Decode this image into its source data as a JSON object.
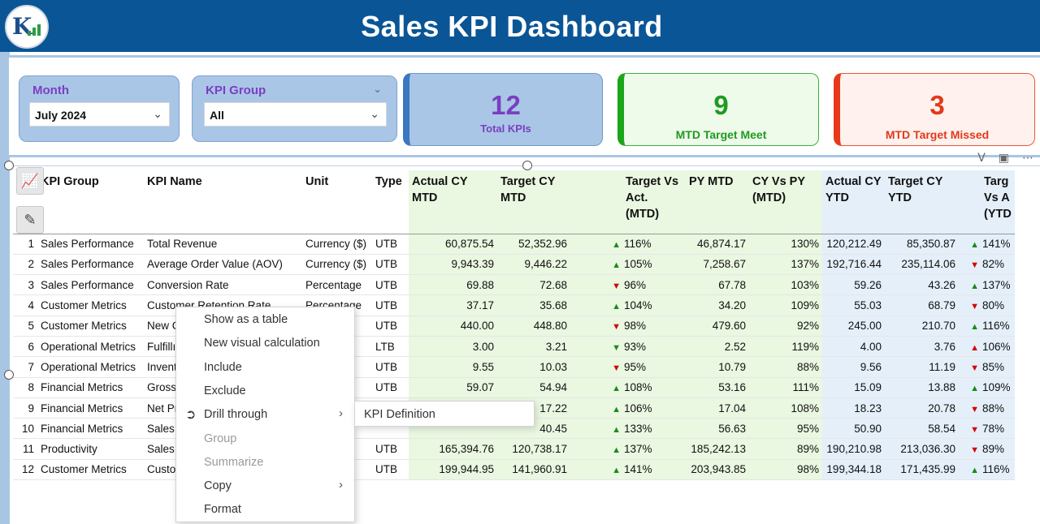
{
  "header": {
    "title": "Sales KPI Dashboard"
  },
  "slicers": {
    "month": {
      "label": "Month",
      "value": "July 2024"
    },
    "kpi_group": {
      "label": "KPI Group",
      "value": "All"
    }
  },
  "cards": {
    "total": {
      "value": "12",
      "caption": "Total KPIs"
    },
    "meet": {
      "value": "9",
      "caption": "MTD Target Meet"
    },
    "missed": {
      "value": "3",
      "caption": "MTD Target Missed"
    }
  },
  "colors": {
    "header_bg": "#0a5596",
    "meet_green": "#1f9a1f",
    "missed_red": "#e03a1a",
    "purple": "#7a3fbf",
    "mtd_bg": "#eaf7e1",
    "ytd_bg": "#e4effa"
  },
  "table": {
    "columns": [
      "KPI Group",
      "KPI Name",
      "Unit",
      "Type",
      "Actual CY MTD",
      "Target CY MTD",
      "Target Vs Act. (MTD)",
      "PY MTD",
      "CY Vs PY (MTD)",
      "Actual CY YTD",
      "Target CY YTD",
      "Targ Vs A (YTD"
    ],
    "rows": [
      {
        "no": "1",
        "group": "Sales Performance",
        "name": "Total Revenue",
        "unit": "Currency ($)",
        "type": "UTB",
        "act_mtd": "60,875.54",
        "tgt_mtd": "52,352.96",
        "mtd_dir": "up",
        "mtd_pct": "116%",
        "py_mtd": "46,874.17",
        "cy_py": "130%",
        "act_ytd": "120,212.49",
        "tgt_ytd": "85,350.87",
        "ytd_dir": "up",
        "ytd_pct": "141%"
      },
      {
        "no": "2",
        "group": "Sales Performance",
        "name": "Average Order Value (AOV)",
        "unit": "Currency ($)",
        "type": "UTB",
        "act_mtd": "9,943.39",
        "tgt_mtd": "9,446.22",
        "mtd_dir": "up",
        "mtd_pct": "105%",
        "py_mtd": "7,258.67",
        "cy_py": "137%",
        "act_ytd": "192,716.44",
        "tgt_ytd": "235,114.06",
        "ytd_dir": "down",
        "ytd_pct": "82%"
      },
      {
        "no": "3",
        "group": "Sales Performance",
        "name": "Conversion Rate",
        "unit": "Percentage",
        "type": "UTB",
        "act_mtd": "69.88",
        "tgt_mtd": "72.68",
        "mtd_dir": "down",
        "mtd_pct": "96%",
        "py_mtd": "67.78",
        "cy_py": "103%",
        "act_ytd": "59.26",
        "tgt_ytd": "43.26",
        "ytd_dir": "up",
        "ytd_pct": "137%"
      },
      {
        "no": "4",
        "group": "Customer Metrics",
        "name": "Customer Retention Rate",
        "unit": "Percentage",
        "type": "UTB",
        "act_mtd": "37.17",
        "tgt_mtd": "35.68",
        "mtd_dir": "up",
        "mtd_pct": "104%",
        "py_mtd": "34.20",
        "cy_py": "109%",
        "act_ytd": "55.03",
        "tgt_ytd": "68.79",
        "ytd_dir": "down",
        "ytd_pct": "80%"
      },
      {
        "no": "5",
        "group": "Customer Metrics",
        "name": "New C",
        "unit": "",
        "type": "UTB",
        "act_mtd": "440.00",
        "tgt_mtd": "448.80",
        "mtd_dir": "down",
        "mtd_pct": "98%",
        "py_mtd": "479.60",
        "cy_py": "92%",
        "act_ytd": "245.00",
        "tgt_ytd": "210.70",
        "ytd_dir": "up",
        "ytd_pct": "116%"
      },
      {
        "no": "6",
        "group": "Operational Metrics",
        "name": "Fulfillı",
        "unit": "",
        "type": "LTB",
        "act_mtd": "3.00",
        "tgt_mtd": "3.21",
        "mtd_dir": "downg",
        "mtd_pct": "93%",
        "py_mtd": "2.52",
        "cy_py": "119%",
        "act_ytd": "4.00",
        "tgt_ytd": "3.76",
        "ytd_dir": "upr",
        "ytd_pct": "106%"
      },
      {
        "no": "7",
        "group": "Operational Metrics",
        "name": "Invent",
        "unit": "",
        "type": "UTB",
        "act_mtd": "9.55",
        "tgt_mtd": "10.03",
        "mtd_dir": "down",
        "mtd_pct": "95%",
        "py_mtd": "10.79",
        "cy_py": "88%",
        "act_ytd": "9.56",
        "tgt_ytd": "11.19",
        "ytd_dir": "down",
        "ytd_pct": "85%"
      },
      {
        "no": "8",
        "group": "Financial Metrics",
        "name": "Gross",
        "unit": "e",
        "type": "UTB",
        "act_mtd": "59.07",
        "tgt_mtd": "54.94",
        "mtd_dir": "up",
        "mtd_pct": "108%",
        "py_mtd": "53.16",
        "cy_py": "111%",
        "act_ytd": "15.09",
        "tgt_ytd": "13.88",
        "ytd_dir": "up",
        "ytd_pct": "109%"
      },
      {
        "no": "9",
        "group": "Financial Metrics",
        "name": "Net Pr",
        "unit": "",
        "type": "",
        "act_mtd": "",
        "tgt_mtd": "17.22",
        "mtd_dir": "up",
        "mtd_pct": "106%",
        "py_mtd": "17.04",
        "cy_py": "108%",
        "act_ytd": "18.23",
        "tgt_ytd": "20.78",
        "ytd_dir": "down",
        "ytd_pct": "88%"
      },
      {
        "no": "10",
        "group": "Financial Metrics",
        "name": "Sales (",
        "unit": "",
        "type": "",
        "act_mtd": "",
        "tgt_mtd": "40.45",
        "mtd_dir": "up",
        "mtd_pct": "133%",
        "py_mtd": "56.63",
        "cy_py": "95%",
        "act_ytd": "50.90",
        "tgt_ytd": "58.54",
        "ytd_dir": "down",
        "ytd_pct": "78%"
      },
      {
        "no": "11",
        "group": "Productivity",
        "name": "Sales p",
        "unit": "$)",
        "type": "UTB",
        "act_mtd": "165,394.76",
        "tgt_mtd": "120,738.17",
        "mtd_dir": "up",
        "mtd_pct": "137%",
        "py_mtd": "185,242.13",
        "cy_py": "89%",
        "act_ytd": "190,210.98",
        "tgt_ytd": "213,036.30",
        "ytd_dir": "down",
        "ytd_pct": "89%"
      },
      {
        "no": "12",
        "group": "Customer Metrics",
        "name": "Custo",
        "unit": "$)",
        "type": "UTB",
        "act_mtd": "199,944.95",
        "tgt_mtd": "141,960.91",
        "mtd_dir": "up",
        "mtd_pct": "141%",
        "py_mtd": "203,943.85",
        "cy_py": "98%",
        "act_ytd": "199,344.18",
        "tgt_ytd": "171,435.99",
        "ytd_dir": "up",
        "ytd_pct": "116%"
      }
    ]
  },
  "context_menu": {
    "items": [
      "Show as a table",
      "New visual calculation",
      "Include",
      "Exclude",
      "Drill through",
      "Group",
      "Summarize",
      "Copy",
      "Format"
    ],
    "submenu": [
      "KPI Definition"
    ]
  },
  "icons": [
    "filter-icon",
    "focus-mode-icon",
    "more-options-icon",
    "build-visual-icon",
    "format-visual-icon",
    "drill-through-icon"
  ]
}
